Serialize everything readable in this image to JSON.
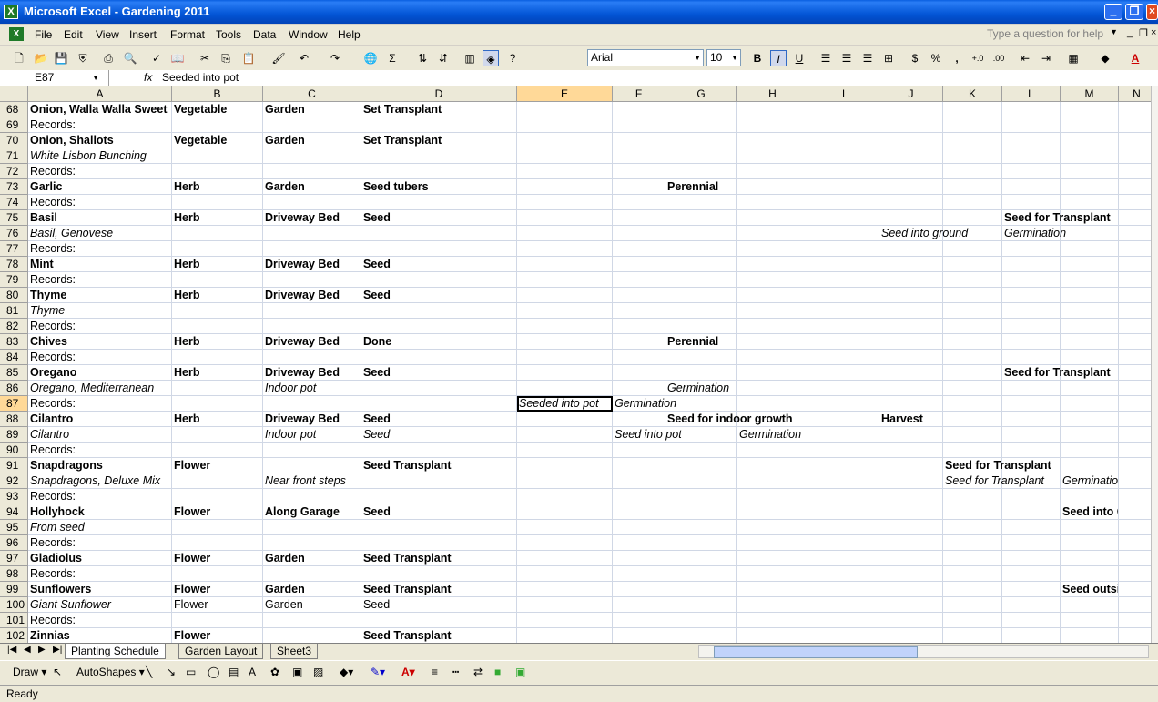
{
  "window": {
    "title": "Microsoft Excel - Gardening 2011"
  },
  "menu": [
    "File",
    "Edit",
    "View",
    "Insert",
    "Format",
    "Tools",
    "Data",
    "Window",
    "Help"
  ],
  "help_placeholder": "Type a question for help",
  "toolbar": {
    "font_name": "Arial",
    "font_size": "10",
    "bold": "B",
    "italic": "I",
    "underline": "U",
    "currency": "$",
    "percent": "%",
    "comma": ","
  },
  "formula_bar": {
    "name_box": "E87",
    "fx": "fx",
    "content": "Seeded into pot"
  },
  "columns": [
    "A",
    "B",
    "C",
    "D",
    "E",
    "F",
    "G",
    "H",
    "I",
    "J",
    "K",
    "L",
    "M",
    "N"
  ],
  "rows": [
    {
      "n": "68",
      "cells": [
        [
          "A",
          "Onion, Walla Walla Sweet",
          "b"
        ],
        [
          "B",
          "Vegetable",
          "b"
        ],
        [
          "C",
          "Garden",
          "b"
        ],
        [
          "D",
          "Set Transplant",
          "b"
        ]
      ]
    },
    {
      "n": "69",
      "cells": [
        [
          "A",
          "Records:",
          ""
        ]
      ]
    },
    {
      "n": "70",
      "cells": [
        [
          "A",
          "Onion, Shallots",
          "b"
        ],
        [
          "B",
          "Vegetable",
          "b"
        ],
        [
          "C",
          "Garden",
          "b"
        ],
        [
          "D",
          "Set Transplant",
          "b"
        ]
      ]
    },
    {
      "n": "71",
      "cells": [
        [
          "A",
          "White Lisbon Bunching",
          "i"
        ]
      ]
    },
    {
      "n": "72",
      "cells": [
        [
          "A",
          "Records:",
          ""
        ]
      ]
    },
    {
      "n": "73",
      "cells": [
        [
          "A",
          "Garlic",
          "b"
        ],
        [
          "B",
          "Herb",
          "b"
        ],
        [
          "C",
          "Garden",
          "b"
        ],
        [
          "D",
          "Seed tubers",
          "b"
        ],
        [
          "G",
          "Perennial",
          "b"
        ]
      ]
    },
    {
      "n": "74",
      "cells": [
        [
          "A",
          "Records:",
          ""
        ]
      ]
    },
    {
      "n": "75",
      "cells": [
        [
          "A",
          "Basil",
          "b"
        ],
        [
          "B",
          "Herb",
          "b"
        ],
        [
          "C",
          "Driveway Bed",
          "b"
        ],
        [
          "D",
          "Seed",
          "b"
        ],
        [
          "L",
          "Seed for Transplant",
          "b"
        ]
      ]
    },
    {
      "n": "76",
      "cells": [
        [
          "A",
          "Basil, Genovese",
          "i"
        ],
        [
          "J",
          "Seed into ground",
          "i"
        ],
        [
          "L",
          "Germination",
          "i"
        ]
      ]
    },
    {
      "n": "77",
      "cells": [
        [
          "A",
          "Records:",
          ""
        ]
      ]
    },
    {
      "n": "78",
      "cells": [
        [
          "A",
          "Mint",
          "b"
        ],
        [
          "B",
          "Herb",
          "b"
        ],
        [
          "C",
          "Driveway Bed",
          "b"
        ],
        [
          "D",
          "Seed",
          "b"
        ]
      ]
    },
    {
      "n": "79",
      "cells": [
        [
          "A",
          "Records:",
          ""
        ]
      ]
    },
    {
      "n": "80",
      "cells": [
        [
          "A",
          "Thyme",
          "b"
        ],
        [
          "B",
          "Herb",
          "b"
        ],
        [
          "C",
          "Driveway Bed",
          "b"
        ],
        [
          "D",
          "Seed",
          "b"
        ]
      ]
    },
    {
      "n": "81",
      "cells": [
        [
          "A",
          "Thyme",
          "i"
        ]
      ]
    },
    {
      "n": "82",
      "cells": [
        [
          "A",
          "Records:",
          ""
        ]
      ]
    },
    {
      "n": "83",
      "cells": [
        [
          "A",
          "Chives",
          "b"
        ],
        [
          "B",
          "Herb",
          "b"
        ],
        [
          "C",
          "Driveway Bed",
          "b"
        ],
        [
          "D",
          "Done",
          "b"
        ],
        [
          "G",
          "Perennial",
          "b"
        ]
      ]
    },
    {
      "n": "84",
      "cells": [
        [
          "A",
          "Records:",
          ""
        ]
      ]
    },
    {
      "n": "85",
      "cells": [
        [
          "A",
          "Oregano",
          "b"
        ],
        [
          "B",
          "Herb",
          "b"
        ],
        [
          "C",
          "Driveway Bed",
          "b"
        ],
        [
          "D",
          "Seed",
          "b"
        ],
        [
          "L",
          "Seed for Transplant",
          "b"
        ]
      ]
    },
    {
      "n": "86",
      "cells": [
        [
          "A",
          "Oregano, Mediterranean",
          "i"
        ],
        [
          "C",
          "Indoor pot",
          "i"
        ],
        [
          "G",
          "Germination",
          "i"
        ]
      ]
    },
    {
      "n": "87",
      "cells": [
        [
          "A",
          "Records:",
          ""
        ],
        [
          "E",
          "Seeded into pot",
          "i sel"
        ],
        [
          "F",
          "Germination",
          "i"
        ]
      ]
    },
    {
      "n": "88",
      "cells": [
        [
          "A",
          "Cilantro",
          "b"
        ],
        [
          "B",
          "Herb",
          "b"
        ],
        [
          "C",
          "Driveway Bed",
          "b"
        ],
        [
          "D",
          "Seed",
          "b"
        ],
        [
          "G",
          "Seed for indoor growth",
          "b"
        ],
        [
          "J",
          "Harvest",
          "b"
        ]
      ]
    },
    {
      "n": "89",
      "cells": [
        [
          "A",
          "Cilantro",
          "i"
        ],
        [
          "C",
          "Indoor pot",
          "i"
        ],
        [
          "D",
          "Seed",
          "i"
        ],
        [
          "F",
          "Seed into pot",
          "i"
        ],
        [
          "H",
          "Germination",
          "i"
        ]
      ]
    },
    {
      "n": "90",
      "cells": [
        [
          "A",
          "Records:",
          ""
        ]
      ]
    },
    {
      "n": "91",
      "cells": [
        [
          "A",
          "Snapdragons",
          "b"
        ],
        [
          "B",
          "Flower",
          "b"
        ],
        [
          "D",
          "Seed Transplant",
          "b"
        ],
        [
          "K",
          "Seed for Transplant",
          "b"
        ]
      ]
    },
    {
      "n": "92",
      "cells": [
        [
          "A",
          "Snapdragons, Deluxe Mix",
          "i"
        ],
        [
          "C",
          "Near front steps",
          "i"
        ],
        [
          "K",
          "Seed for Transplant",
          "i"
        ],
        [
          "M",
          "Germination",
          "i"
        ]
      ]
    },
    {
      "n": "93",
      "cells": [
        [
          "A",
          "Records:",
          ""
        ]
      ]
    },
    {
      "n": "94",
      "cells": [
        [
          "A",
          "Hollyhock",
          "b"
        ],
        [
          "B",
          "Flower",
          "b"
        ],
        [
          "C",
          "Along Garage",
          "b"
        ],
        [
          "D",
          "Seed",
          "b"
        ],
        [
          "M",
          "Seed into Garden",
          "b"
        ]
      ]
    },
    {
      "n": "95",
      "cells": [
        [
          "A",
          "From seed",
          "i"
        ]
      ]
    },
    {
      "n": "96",
      "cells": [
        [
          "A",
          "Records:",
          ""
        ]
      ]
    },
    {
      "n": "97",
      "cells": [
        [
          "A",
          "Gladiolus",
          "b"
        ],
        [
          "B",
          "Flower",
          "b"
        ],
        [
          "C",
          "Garden",
          "b"
        ],
        [
          "D",
          "Seed Transplant",
          "b"
        ]
      ]
    },
    {
      "n": "98",
      "cells": [
        [
          "A",
          "Records:",
          ""
        ]
      ]
    },
    {
      "n": "99",
      "cells": [
        [
          "A",
          "Sunflowers",
          "b"
        ],
        [
          "B",
          "Flower",
          "b"
        ],
        [
          "C",
          "Garden",
          "b"
        ],
        [
          "D",
          "Seed Transplant",
          "b"
        ],
        [
          "M",
          "Seed outside",
          "b"
        ]
      ]
    },
    {
      "n": "100",
      "cells": [
        [
          "A",
          "Giant Sunflower",
          "i"
        ],
        [
          "B",
          "Flower",
          ""
        ],
        [
          "C",
          "Garden",
          ""
        ],
        [
          "D",
          "Seed",
          ""
        ]
      ]
    },
    {
      "n": "101",
      "cells": [
        [
          "A",
          "Records:",
          ""
        ]
      ]
    },
    {
      "n": "102",
      "cells": [
        [
          "A",
          "Zinnias",
          "b"
        ],
        [
          "B",
          "Flower",
          "b"
        ],
        [
          "D",
          "Seed Transplant",
          "b"
        ]
      ]
    }
  ],
  "active": {
    "col": "E",
    "row": "87"
  },
  "sheets": [
    {
      "name": "Planting Schedule",
      "active": true
    },
    {
      "name": "Garden Layout",
      "active": false
    },
    {
      "name": "Sheet3",
      "active": false
    }
  ],
  "drawbar": {
    "draw": "Draw",
    "autoshapes": "AutoShapes"
  },
  "status": "Ready"
}
